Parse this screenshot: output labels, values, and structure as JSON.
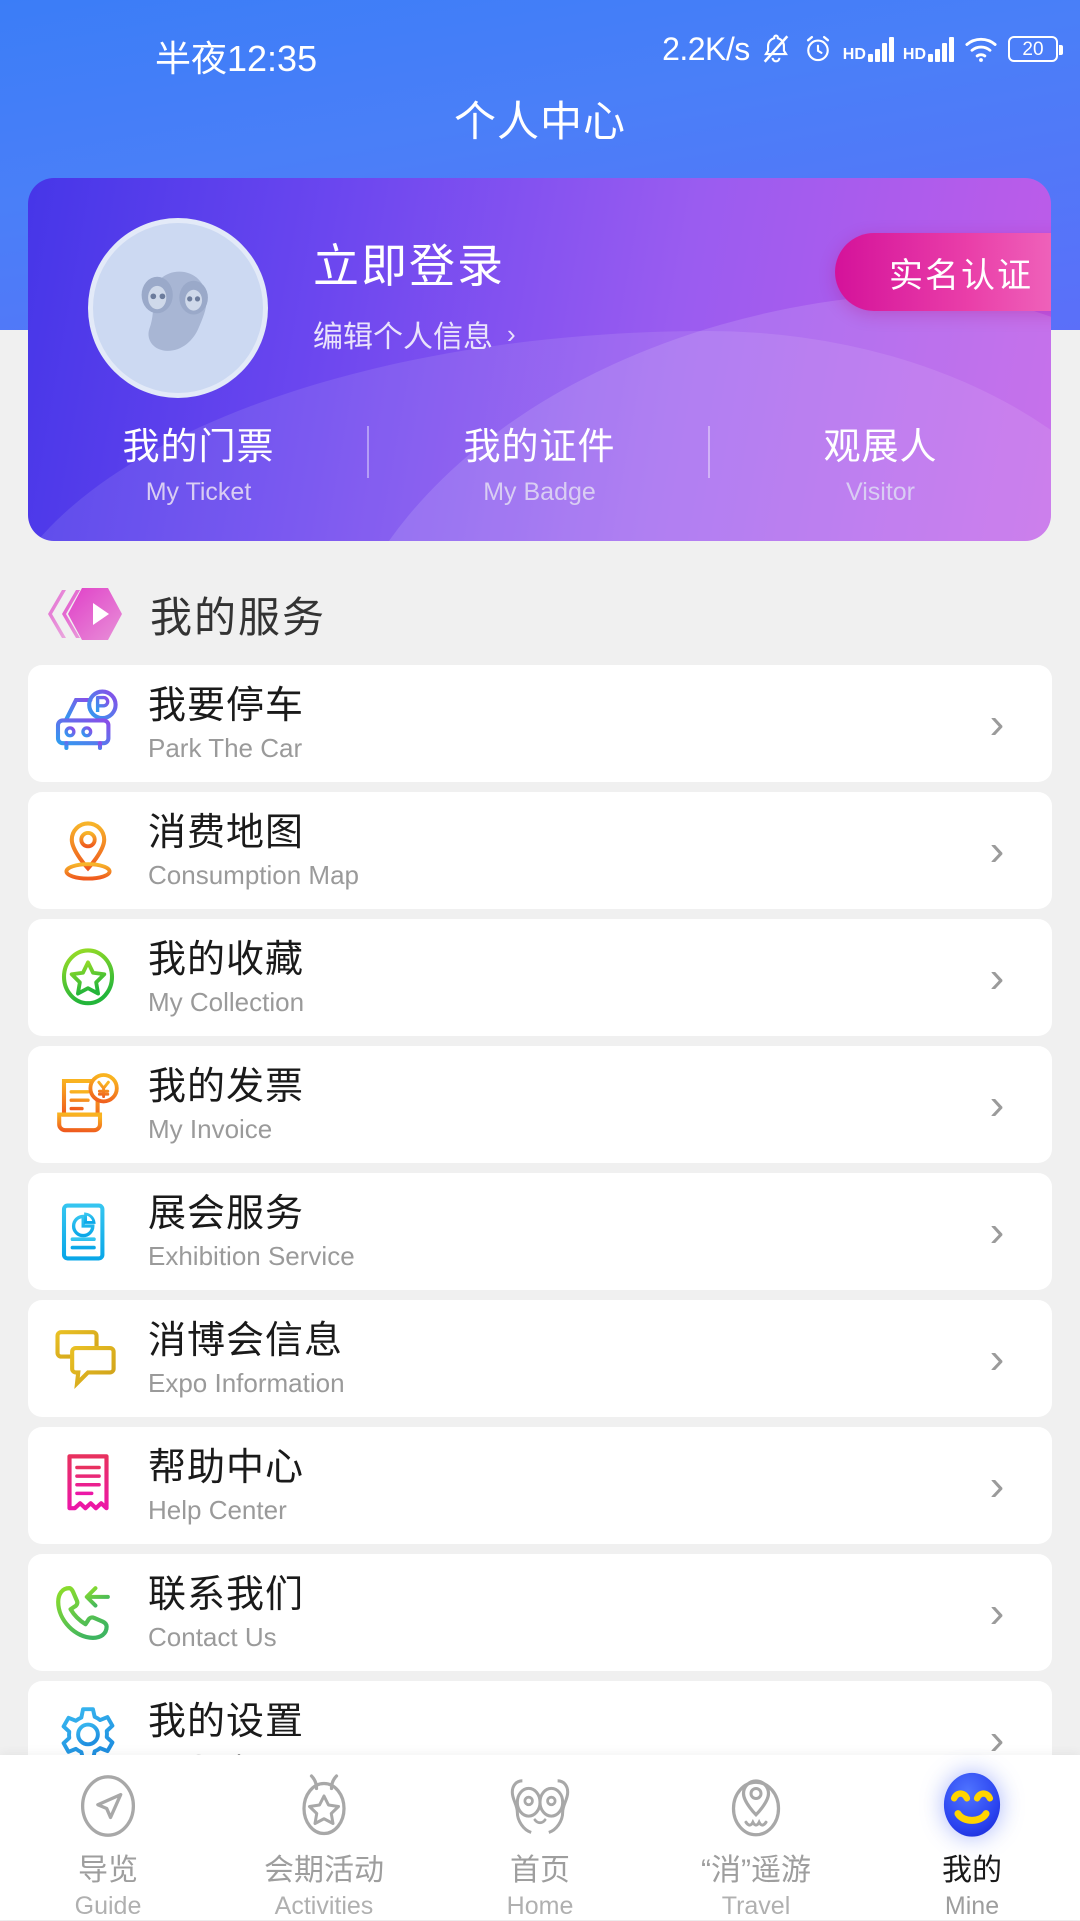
{
  "statusbar": {
    "time": "半夜12:35",
    "network_speed": "2.2K/s",
    "mute_icon": "bell-mute-icon",
    "alarm_icon": "alarm-clock-icon",
    "sim1_label": "HD",
    "sim2_label": "HD",
    "wifi_icon": "wifi-icon",
    "battery_level": "20"
  },
  "header": {
    "title": "个人中心"
  },
  "profile": {
    "avatar_icon": "default-avatar-icon",
    "login_label": "立即登录",
    "edit_label": "编辑个人信息",
    "edit_chevron": "›",
    "verify_label": "实名认证",
    "tabs": [
      {
        "cn": "我的门票",
        "en": "My Ticket"
      },
      {
        "cn": "我的证件",
        "en": "My Badge"
      },
      {
        "cn": "观展人",
        "en": "Visitor"
      }
    ]
  },
  "section": {
    "icon": "play-hexagon-icon",
    "title": "我的服务"
  },
  "services": [
    {
      "cn": "我要停车",
      "en": "Park The Car",
      "icon": "parking-car-icon",
      "chevron": "›"
    },
    {
      "cn": "消费地图",
      "en": "Consumption Map",
      "icon": "map-pin-icon",
      "chevron": "›"
    },
    {
      "cn": "我的收藏",
      "en": "My Collection",
      "icon": "star-circle-icon",
      "chevron": "›"
    },
    {
      "cn": "我的发票",
      "en": "My Invoice",
      "icon": "invoice-yuan-icon",
      "chevron": "›"
    },
    {
      "cn": "展会服务",
      "en": "Exhibition Service",
      "icon": "exhibition-document-icon",
      "chevron": "›"
    },
    {
      "cn": "消博会信息",
      "en": "Expo Information",
      "icon": "chat-bubbles-icon",
      "chevron": "›"
    },
    {
      "cn": "帮助中心",
      "en": "Help Center",
      "icon": "help-receipt-icon",
      "chevron": "›"
    },
    {
      "cn": "联系我们",
      "en": "Contact Us",
      "icon": "phone-callback-icon",
      "chevron": "›"
    },
    {
      "cn": "我的设置",
      "en": "My Settings",
      "icon": "gear-icon",
      "chevron": "›"
    }
  ],
  "bottom_nav": [
    {
      "cn": "导览",
      "en": "Guide",
      "icon": "compass-navigate-icon",
      "active": false
    },
    {
      "cn": "会期活动",
      "en": "Activities",
      "icon": "medal-star-icon",
      "active": false
    },
    {
      "cn": "首页",
      "en": "Home",
      "icon": "mascot-home-icon",
      "active": false
    },
    {
      "cn": "“消”遥游",
      "en": "Travel",
      "icon": "location-face-icon",
      "active": false
    },
    {
      "cn": "我的",
      "en": "Mine",
      "icon": "smiley-face-icon",
      "active": true
    }
  ],
  "colors": {
    "header_blue": "#4a7ff8",
    "card_purple_start": "#4636e8",
    "card_purple_end": "#c05ce8",
    "badge_pink": "#d4129a",
    "active_nav_blue": "#2b4ef0",
    "page_bg": "#f0f0f0"
  }
}
